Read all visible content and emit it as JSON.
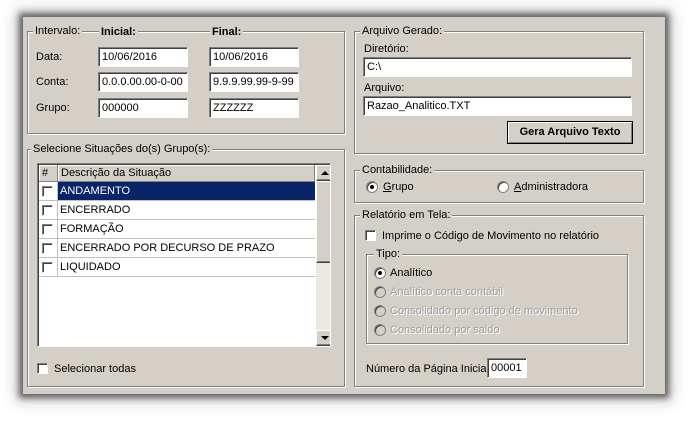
{
  "intervalo": {
    "label": "Intervalo:",
    "inicial_header": "Inicial:",
    "final_header": "Final:",
    "data_label": "Data:",
    "conta_label": "Conta:",
    "grupo_label": "Grupo:",
    "data_inicial": "10/06/2016",
    "data_final": "10/06/2016",
    "conta_inicial": "0.0.0.00.00-0-00",
    "conta_final": "9.9.9.99.99-9-99",
    "grupo_inicial": "000000",
    "grupo_final": "ZZZZZZ"
  },
  "situacoes": {
    "legend": "Selecione Situações do(s) Grupo(s):",
    "col_hash": "#",
    "col_desc": "Descrição da Situação",
    "items": [
      {
        "label": "ANDAMENTO",
        "checked": false,
        "selected": true
      },
      {
        "label": "ENCERRADO",
        "checked": false,
        "selected": false
      },
      {
        "label": "FORMAÇÃO",
        "checked": false,
        "selected": false
      },
      {
        "label": "ENCERRADO POR DECURSO DE PRAZO",
        "checked": false,
        "selected": false
      },
      {
        "label": "LIQUIDADO",
        "checked": false,
        "selected": false
      }
    ],
    "select_all_label": "Selecionar todas"
  },
  "arquivo": {
    "legend": "Arquivo Gerado:",
    "diretorio_label": "Diretório:",
    "diretorio_value": "C:\\",
    "arquivo_label": "Arquivo:",
    "arquivo_value": "Razao_Analitico.TXT",
    "gera_button": "Gera Arquivo Texto"
  },
  "contabilidade": {
    "legend": "Contabilidade:",
    "grupo_first": "G",
    "grupo_rest": "rupo",
    "admin_first": "A",
    "admin_rest": "dministradora",
    "selected": "grupo"
  },
  "relatorio": {
    "legend": "Relatório em Tela:",
    "imprime_label": "Imprime o Código de Movimento no relatório",
    "tipo_legend": "Tipo:",
    "tipos": [
      {
        "label": "Analítico",
        "enabled": true,
        "selected": true
      },
      {
        "label": "Analítico conta contábil",
        "enabled": false,
        "selected": false
      },
      {
        "label": "Consolidado por código de movimento",
        "enabled": false,
        "selected": false
      },
      {
        "label": "Consolidado por saldo",
        "enabled": false,
        "selected": false
      }
    ],
    "pagina_label": "Número da Página Inicial:",
    "pagina_value": "00001"
  },
  "colors": {
    "face": "#d4d0c8",
    "selection": "#0a246a"
  },
  "icons": [
    "scroll-up-arrow-icon",
    "scroll-down-arrow-icon",
    "radio-dot-icon"
  ]
}
